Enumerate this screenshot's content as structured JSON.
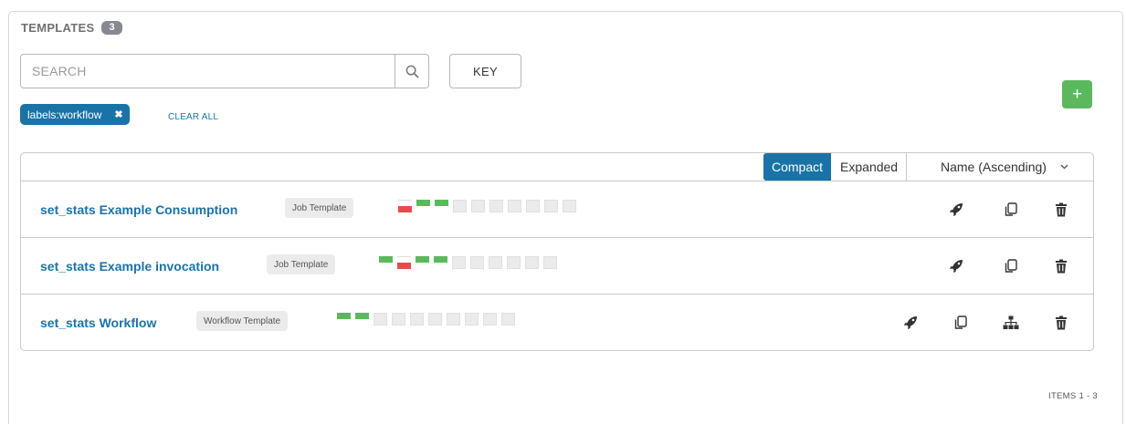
{
  "header": {
    "title": "TEMPLATES",
    "count": "3"
  },
  "search": {
    "placeholder": "SEARCH",
    "value": ""
  },
  "key_label": "KEY",
  "add_label": "+",
  "filter_tag": {
    "label": "labels:workflow",
    "remove": "✖"
  },
  "clear_all": "CLEAR ALL",
  "view": {
    "compact": "Compact",
    "expanded": "Expanded",
    "active": "Compact"
  },
  "sort": {
    "label": "Name (Ascending)",
    "chevron": "⌄"
  },
  "templates": [
    {
      "name": "set_stats Example Consumption",
      "type": "Job Template",
      "recent_jobs": [
        "failed",
        "successful",
        "successful",
        "none",
        "none",
        "none",
        "none",
        "none",
        "none",
        "none"
      ],
      "actions": [
        "launch-icon",
        "copy-icon",
        "delete-icon"
      ]
    },
    {
      "name": "set_stats Example invocation",
      "type": "Job Template",
      "recent_jobs": [
        "successful",
        "failed",
        "successful",
        "successful",
        "none",
        "none",
        "none",
        "none",
        "none",
        "none"
      ],
      "actions": [
        "launch-icon",
        "copy-icon",
        "delete-icon"
      ]
    },
    {
      "name": "set_stats Workflow",
      "type": "Workflow Template",
      "recent_jobs": [
        "successful",
        "successful",
        "none",
        "none",
        "none",
        "none",
        "none",
        "none",
        "none",
        "none"
      ],
      "actions": [
        "launch-icon",
        "copy-icon",
        "workflow-visualizer-icon",
        "delete-icon"
      ]
    }
  ],
  "colors": {
    "brand": "#1a73a6",
    "success": "#5cb85c",
    "failed": "#e74c4c"
  },
  "footer": "ITEMS  1 - 3"
}
